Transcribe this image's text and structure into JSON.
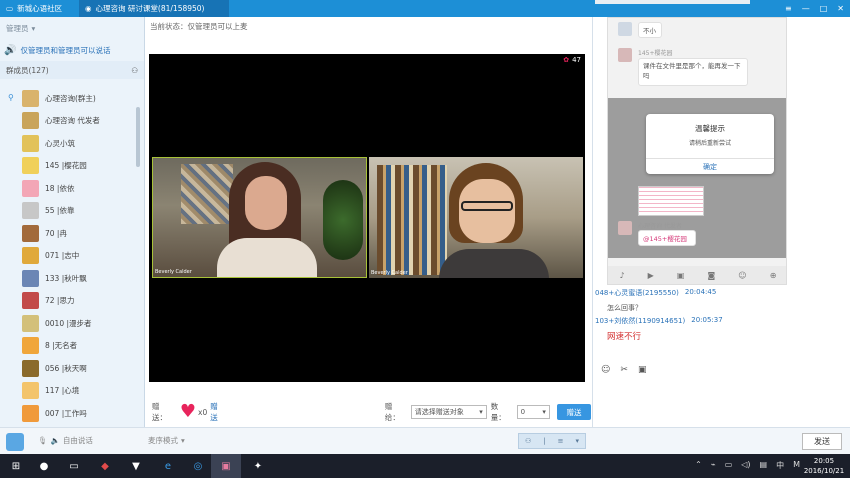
{
  "titlebar": {
    "tab1_label": "新城心语社区",
    "tab2_label": "心理咨询 研讨课堂(81/158950)",
    "ctrl_menu": "≡",
    "ctrl_min": "—",
    "ctrl_max": "□",
    "ctrl_close": "✕"
  },
  "left": {
    "dropdown_label": "管理员",
    "notice": "仅管理员和管理员可以说话",
    "member_count": "群成员(127)",
    "members": [
      {
        "name": "心理咨询(群主)",
        "color": "#d9b36c"
      },
      {
        "name": "心理咨询 代发者",
        "color": "#c9a45a"
      },
      {
        "name": "心灵小筑",
        "color": "#e2c25a"
      },
      {
        "name": "145 |樱花园",
        "color": "#f0d05a"
      },
      {
        "name": "18 |依依",
        "color": "#f3a6b6"
      },
      {
        "name": "55 |依靠",
        "color": "#c7c7c7"
      },
      {
        "name": "70 |冉",
        "color": "#a26a3b"
      },
      {
        "name": "071 |志中",
        "color": "#e0a93b"
      },
      {
        "name": "133 |秋叶飘",
        "color": "#6b86b5"
      },
      {
        "name": "72 |思力",
        "color": "#c24a4a"
      },
      {
        "name": "0010 |漫步者",
        "color": "#d3c07a"
      },
      {
        "name": "8 |无名者",
        "color": "#f0a63b"
      },
      {
        "name": "056 |秋天啊",
        "color": "#8a6a2b"
      },
      {
        "name": "117 |心境",
        "color": "#f3c46b"
      },
      {
        "name": "007 |工作吗",
        "color": "#f09a3b"
      }
    ]
  },
  "center": {
    "status": "当前状态：仅管理员可以上麦",
    "viewer_count": "47",
    "video1_label": "Beverly Calder",
    "video2_label": "Beverly Calder",
    "gift_label": "赠送：",
    "gift_count": "x0",
    "gift_send": "赠送",
    "gift_target_label": "赠给：",
    "gift_target_value": "请选择赠送对象",
    "qty_label": "数量：",
    "qty_value": "0",
    "send_gift_btn": "赠送"
  },
  "right": {
    "phone": {
      "bubble1": "不小",
      "name1": "145+樱花园",
      "bubble2": "课件在文件里是那个，能再发一下吗",
      "dialog_title": "温馨提示",
      "dialog_text": "请稍后重新尝试",
      "dialog_btn": "确定",
      "name2": "心理咨询 代发者",
      "bubble3": "@145+樱花园"
    },
    "chat": [
      {
        "sender": "048+心灵蜜语(2195550)",
        "time": "20:04:45",
        "message": "怎么回事？",
        "red": false
      },
      {
        "sender": "103+刘依然(1190914651)",
        "time": "20:05:37",
        "message": "网速不行",
        "red": true
      }
    ],
    "send_btn": "发送"
  },
  "footer": {
    "voice_label": "自由说话",
    "mic_label": "麦序模式",
    "send_label": "发送"
  },
  "taskbar": {
    "time": "20:05",
    "date": "2016/10/21",
    "ime": "中",
    "ime2": "M"
  }
}
